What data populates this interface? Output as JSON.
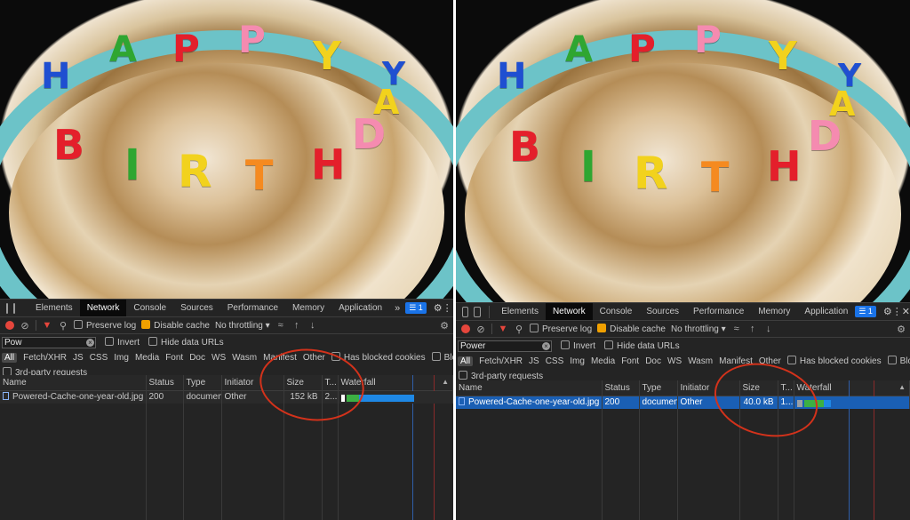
{
  "panes": [
    {
      "id": "left",
      "panel_tabs": [
        "Elements",
        "Network",
        "Console",
        "Sources",
        "Performance",
        "Memory",
        "Application"
      ],
      "active_tab": "Network",
      "more_tabs": "»",
      "message_badge": "1",
      "toolbar": {
        "preserve_log": "Preserve log",
        "disable_cache": "Disable cache",
        "throttling": "No throttling"
      },
      "filter": {
        "value": "Pow",
        "invert": "Invert",
        "hide_data_urls": "Hide data URLs",
        "has_blocked_cookies": "Has blocked cookies",
        "blocked_requests": "Blocked Requests",
        "third_party": "3rd-party requests"
      },
      "types": [
        "All",
        "Fetch/XHR",
        "JS",
        "CSS",
        "Img",
        "Media",
        "Font",
        "Doc",
        "WS",
        "Wasm",
        "Manifest",
        "Other"
      ],
      "columns": [
        "Name",
        "Status",
        "Type",
        "Initiator",
        "Size",
        "T...",
        "Waterfall"
      ],
      "request": {
        "name": "Powered-Cache-one-year-old.jpg",
        "status": "200",
        "type": "document",
        "initiator": "Other",
        "size": "152 kB",
        "time": "2..."
      }
    },
    {
      "id": "right",
      "panel_tabs": [
        "Elements",
        "Network",
        "Console",
        "Sources",
        "Performance",
        "Memory",
        "Application"
      ],
      "active_tab": "Network",
      "message_badge": "1",
      "toolbar": {
        "preserve_log": "Preserve log",
        "disable_cache": "Disable cache",
        "throttling": "No throttling"
      },
      "filter": {
        "value": "Power",
        "invert": "Invert",
        "hide_data_urls": "Hide data URLs",
        "has_blocked_cookies": "Has blocked cookies",
        "blocked_requests": "Blocked Requests",
        "third_party": "3rd-party requests"
      },
      "types": [
        "All",
        "Fetch/XHR",
        "JS",
        "CSS",
        "Img",
        "Media",
        "Font",
        "Doc",
        "WS",
        "Wasm",
        "Manifest",
        "Other"
      ],
      "columns": [
        "Name",
        "Status",
        "Type",
        "Initiator",
        "Size",
        "T...",
        "Waterfall"
      ],
      "request": {
        "name": "Powered-Cache-one-year-old.jpg",
        "status": "200",
        "type": "document",
        "initiator": "Other",
        "size": "40.0 kB",
        "time": "1..."
      }
    }
  ],
  "candles": [
    "H",
    "A",
    "P",
    "P",
    "Y",
    "B",
    "I",
    "R",
    "T",
    "H",
    "D",
    "A",
    "Y"
  ],
  "colors": {
    "annotation": "#d3321b",
    "selected_row": "#1a5fb4",
    "record": "#e6463c",
    "waterfall_wait": "#3cb043",
    "waterfall_download": "#1e88e5"
  }
}
